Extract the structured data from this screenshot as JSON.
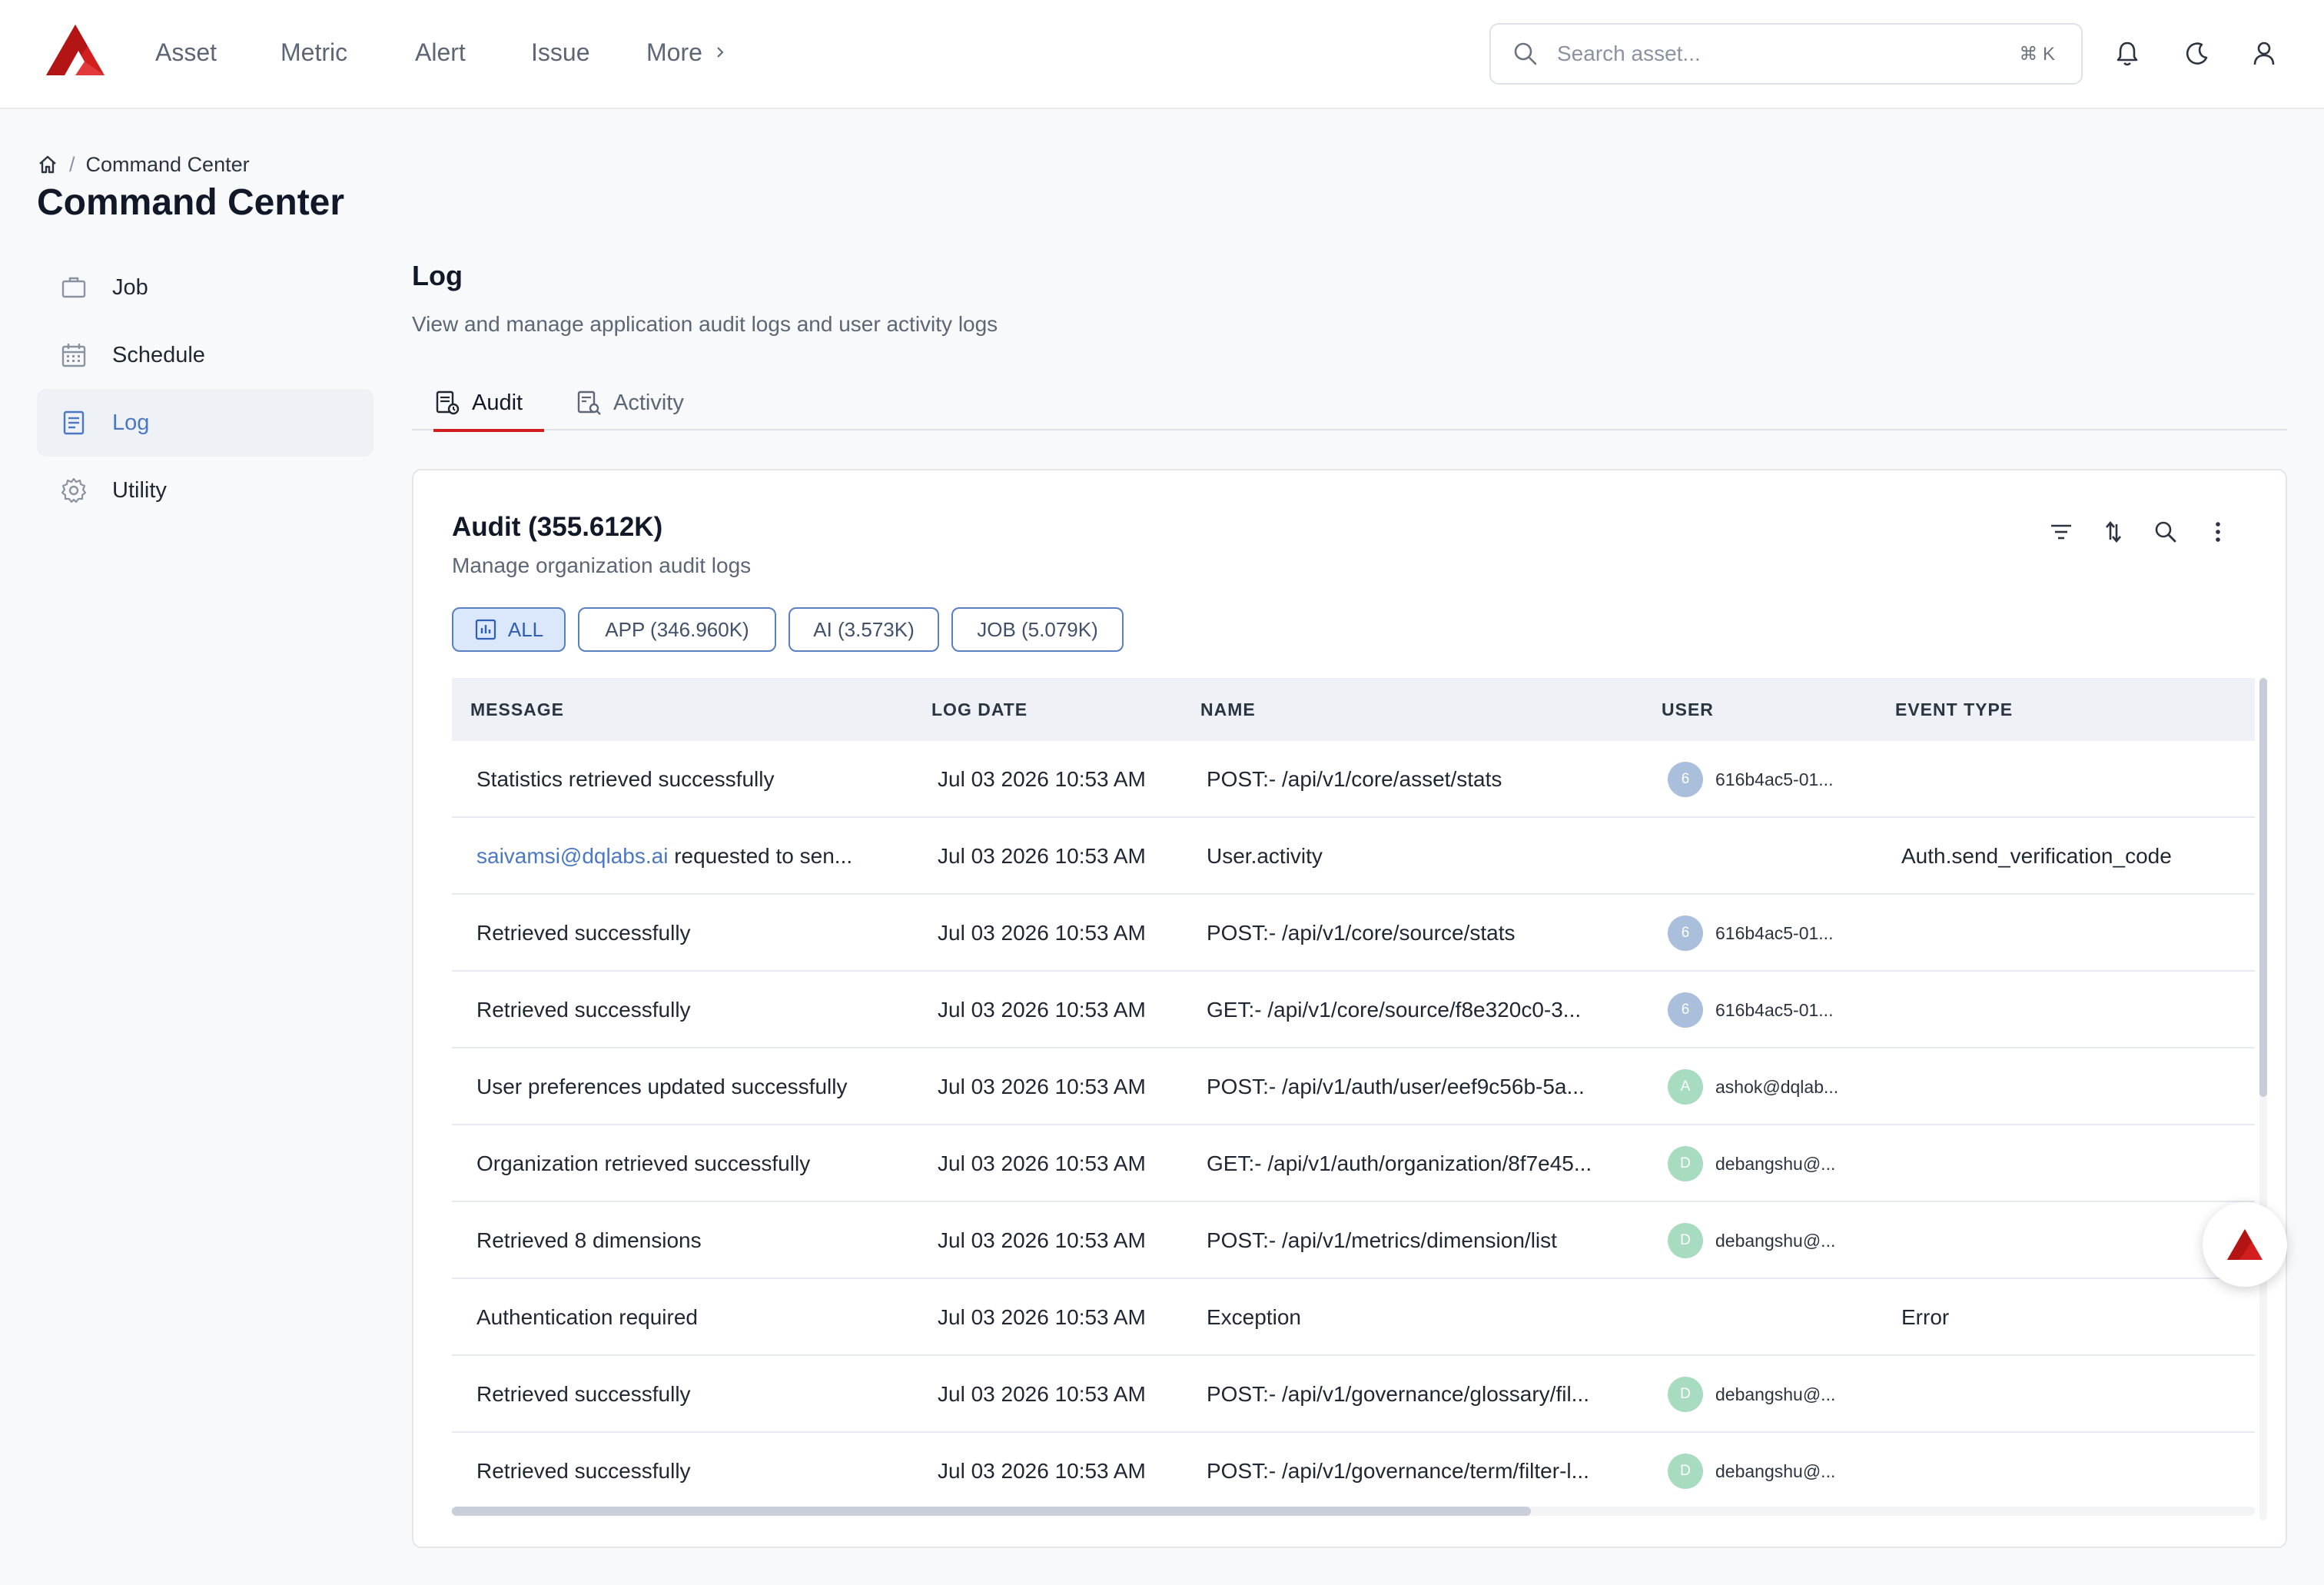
{
  "brand": {
    "logo_icon": "dqlabs-logo-icon",
    "accent": "#d11f1f"
  },
  "nav": {
    "items": [
      "Asset",
      "Metric",
      "Alert",
      "Issue"
    ],
    "more_label": "More"
  },
  "search": {
    "placeholder": "Search asset...",
    "shortcut": "⌘ K"
  },
  "top_icons": [
    "bell-icon",
    "moon-icon",
    "user-icon"
  ],
  "breadcrumb": {
    "current": "Command Center"
  },
  "page_title": "Command Center",
  "sidebar": {
    "items": [
      {
        "label": "Job",
        "icon": "briefcase-icon"
      },
      {
        "label": "Schedule",
        "icon": "calendar-icon"
      },
      {
        "label": "Log",
        "icon": "document-list-icon",
        "active": true
      },
      {
        "label": "Utility",
        "icon": "gear-icon"
      }
    ]
  },
  "log": {
    "title": "Log",
    "description": "View and manage application audit logs and user activity logs",
    "tabs": [
      {
        "label": "Audit",
        "active": true
      },
      {
        "label": "Activity"
      }
    ]
  },
  "audit": {
    "title": "Audit (355.612K)",
    "subtitle": "Manage organization audit logs",
    "tools": [
      "filter-icon",
      "sort-icon",
      "search-icon",
      "more-vertical-icon"
    ],
    "chips": [
      {
        "label": "ALL",
        "active": true
      },
      {
        "label": "APP (346.960K)"
      },
      {
        "label": "AI (3.573K)"
      },
      {
        "label": "JOB (5.079K)"
      }
    ],
    "columns": [
      "MESSAGE",
      "LOG DATE",
      "NAME",
      "USER",
      "EVENT TYPE"
    ],
    "rows": [
      {
        "message": "Statistics retrieved successfully",
        "date": "Jul 03 2026 10:53 AM",
        "name": "POST:- /api/v1/core/asset/stats",
        "avatar": "6",
        "avatar_color": "#a9bfdc",
        "user": "616b4ac5-01...",
        "event": ""
      },
      {
        "message_link": "saivamsi@dqlabs.ai",
        "message": " requested to sen...",
        "date": "Jul 03 2026 10:53 AM",
        "name": "User.activity",
        "avatar": "",
        "avatar_color": "",
        "user": "",
        "event": "Auth.send_verification_code"
      },
      {
        "message": "Retrieved successfully",
        "date": "Jul 03 2026 10:53 AM",
        "name": "POST:- /api/v1/core/source/stats",
        "avatar": "6",
        "avatar_color": "#a9bfdc",
        "user": "616b4ac5-01...",
        "event": ""
      },
      {
        "message": "Retrieved successfully",
        "date": "Jul 03 2026 10:53 AM",
        "name": "GET:- /api/v1/core/source/f8e320c0-3...",
        "avatar": "6",
        "avatar_color": "#a9bfdc",
        "user": "616b4ac5-01...",
        "event": ""
      },
      {
        "message": "User preferences updated successfully",
        "date": "Jul 03 2026 10:53 AM",
        "name": "POST:- /api/v1/auth/user/eef9c56b-5a...",
        "avatar": "A",
        "avatar_color": "#a8dcc0",
        "user": "ashok@dqlab...",
        "event": ""
      },
      {
        "message": "Organization retrieved successfully",
        "date": "Jul 03 2026 10:53 AM",
        "name": "GET:- /api/v1/auth/organization/8f7e45...",
        "avatar": "D",
        "avatar_color": "#a8dcc0",
        "user": "debangshu@...",
        "event": ""
      },
      {
        "message": "Retrieved 8 dimensions",
        "date": "Jul 03 2026 10:53 AM",
        "name": "POST:- /api/v1/metrics/dimension/list",
        "avatar": "D",
        "avatar_color": "#a8dcc0",
        "user": "debangshu@...",
        "event": ""
      },
      {
        "message": "Authentication required",
        "date": "Jul 03 2026 10:53 AM",
        "name": "Exception",
        "avatar": "",
        "avatar_color": "",
        "user": "",
        "event": "Error"
      },
      {
        "message": "Retrieved successfully",
        "date": "Jul 03 2026 10:53 AM",
        "name": "POST:- /api/v1/governance/glossary/fil...",
        "avatar": "D",
        "avatar_color": "#a8dcc0",
        "user": "debangshu@...",
        "event": ""
      },
      {
        "message": "Retrieved successfully",
        "date": "Jul 03 2026 10:53 AM",
        "name": "POST:- /api/v1/governance/term/filter-l...",
        "avatar": "D",
        "avatar_color": "#a8dcc0",
        "user": "debangshu@...",
        "event": ""
      }
    ]
  },
  "fab": {
    "icon": "assistant-logo-icon"
  }
}
